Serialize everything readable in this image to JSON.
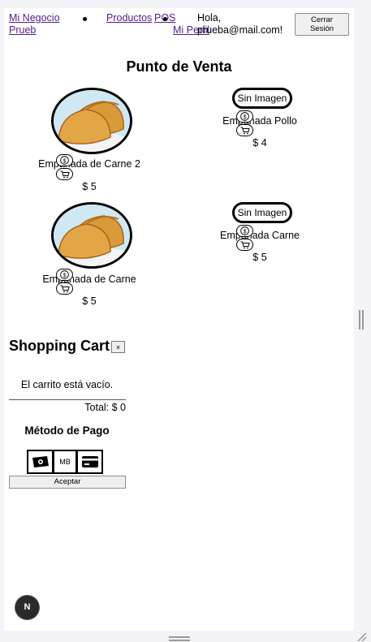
{
  "header": {
    "brand": "Mi Negocio Prueb",
    "nav": {
      "products": "Productos",
      "pos": "POS",
      "profile": "Mi Perfil"
    },
    "greeting": "Hola,",
    "email": "prueba@mail.com!",
    "logout_label": "Cerrar Sesión"
  },
  "pos": {
    "title": "Punto de Venta",
    "products": [
      {
        "name": "Empanada de Carne 2",
        "price": "$ 5",
        "image": "empanada-photo"
      },
      {
        "name": "Empanada Pollo",
        "price": "$ 4",
        "image_placeholder": "Sin Imagen"
      },
      {
        "name": "Empanada de Carne",
        "price": "$ 5",
        "image": "empanada-photo"
      },
      {
        "name": "Empanada Carne",
        "price": "$ 5",
        "image_placeholder": "Sin Imagen"
      }
    ],
    "icons": {
      "price": "dollar-icon",
      "add": "cart-icon"
    }
  },
  "cart": {
    "title": "Shopping Cart",
    "close_label": "×",
    "empty_text": "El carrito está vacío.",
    "total": "Total: $ 0",
    "payment_title": "Método de Pago",
    "payment_options": [
      {
        "id": "cash",
        "icon": "cash-icon"
      },
      {
        "id": "mb",
        "label": "MB"
      },
      {
        "id": "card",
        "icon": "credit-card-icon"
      }
    ],
    "accept_label": "Aceptar"
  },
  "dev_badge": "N"
}
